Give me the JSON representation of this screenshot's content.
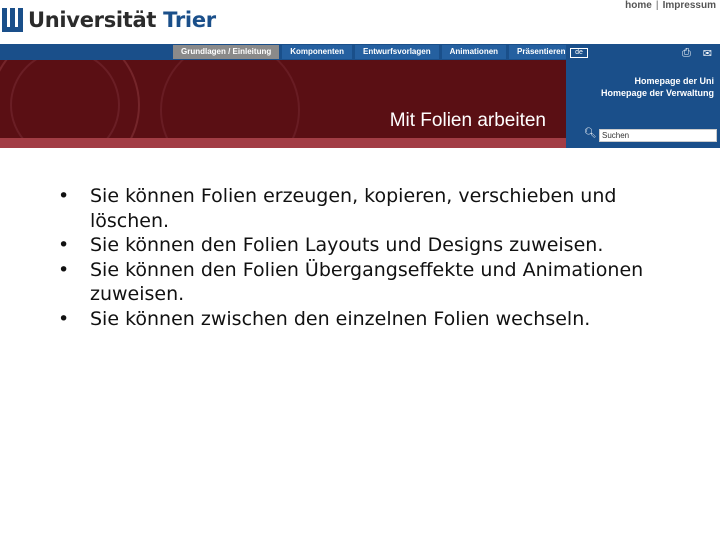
{
  "header": {
    "logo_text_main": "Universität",
    "logo_text_city": "Trier",
    "top_links": [
      "home",
      "Impressum"
    ]
  },
  "nav": {
    "tabs": [
      "Grundlagen / Einleitung",
      "Komponenten",
      "Entwurfsvorlagen",
      "Animationen",
      "Präsentieren"
    ]
  },
  "banner": {
    "title": "Mit Folien arbeiten"
  },
  "panel": {
    "lang": "de",
    "links": [
      "Homepage der Uni",
      "Homepage der Verwaltung"
    ],
    "search_value": "Suchen"
  },
  "content": {
    "bullets": [
      "Sie können Folien erzeugen, kopieren, verschieben und löschen.",
      "Sie können den Folien Layouts und Designs zuweisen.",
      "Sie können den Folien Übergangseffekte und Animationen zuweisen.",
      "Sie können zwischen den einzelnen Folien wechseln."
    ]
  },
  "colors": {
    "nav_blue": "#1a4f8a",
    "banner_red": "#5a0f14"
  }
}
